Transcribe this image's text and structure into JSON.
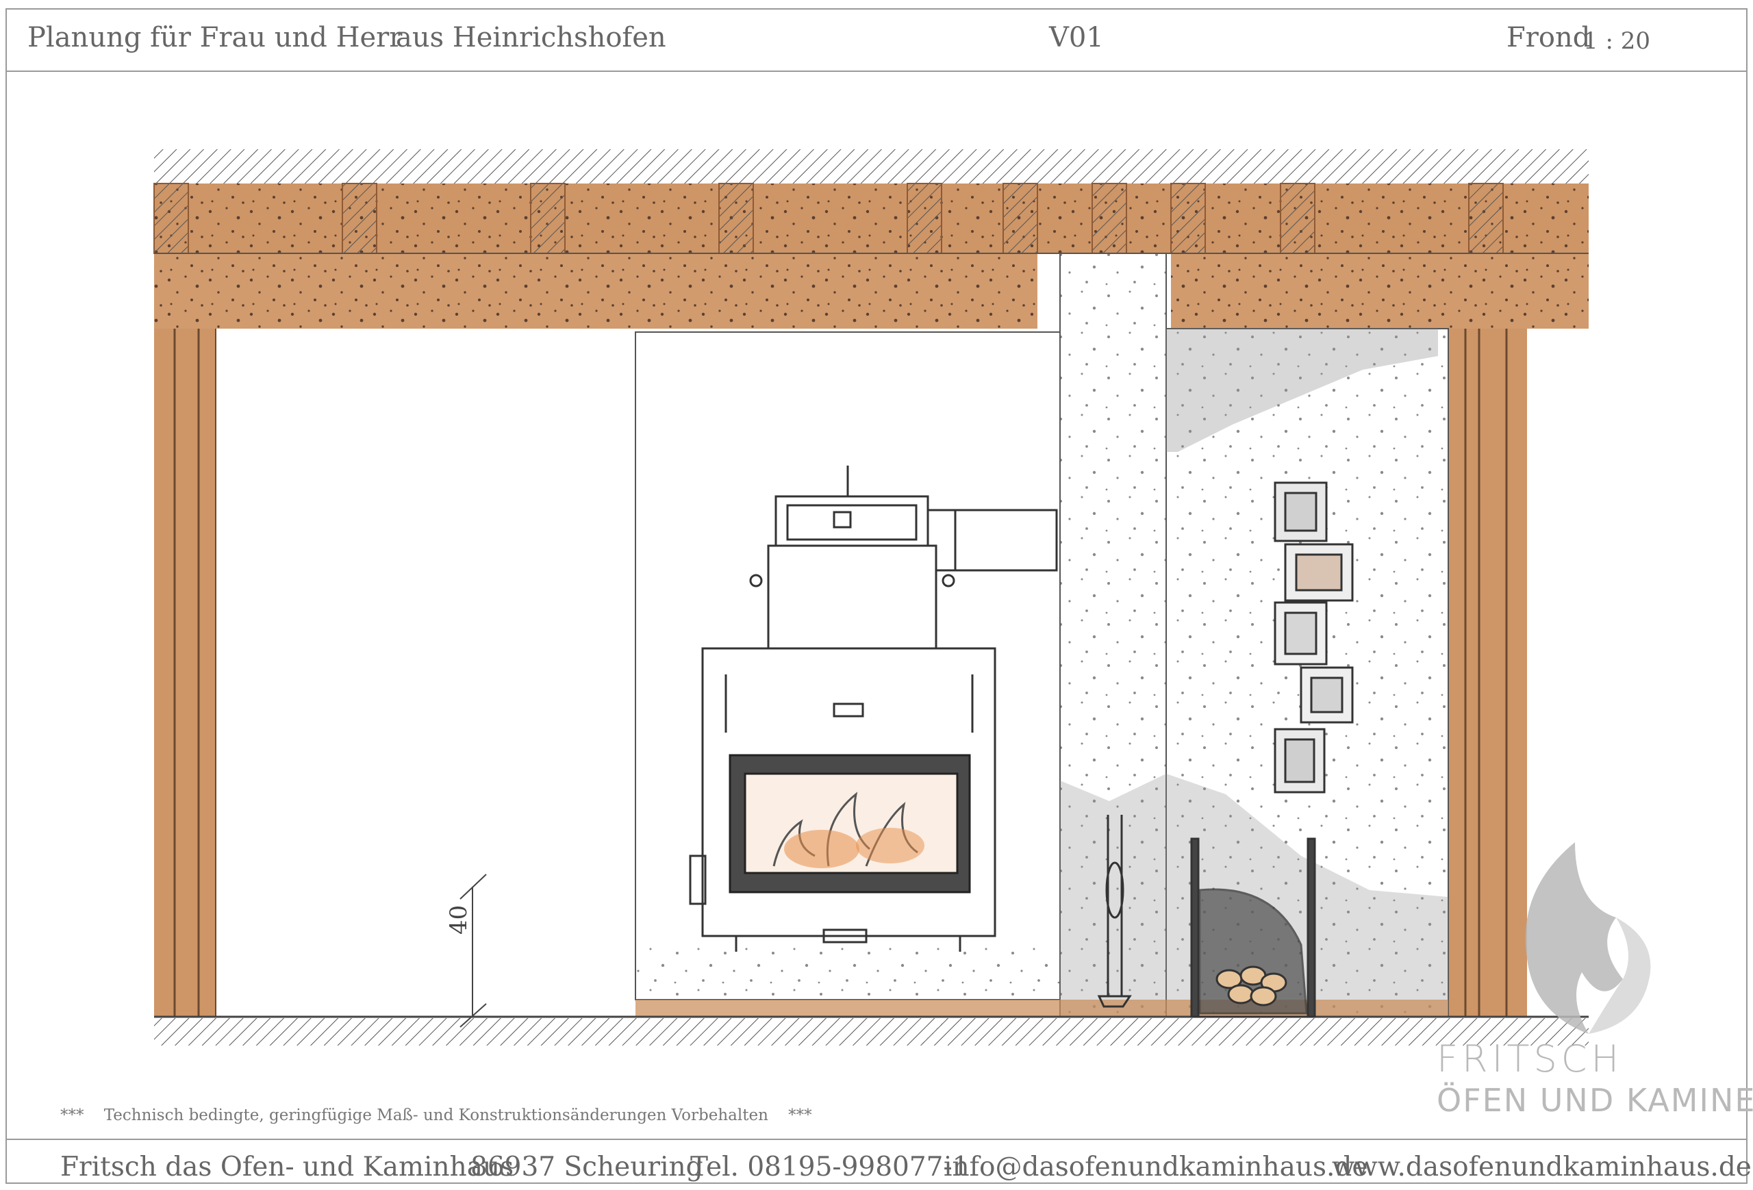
{
  "header": {
    "planning": "Planung für Frau und Herr",
    "location": "aus Heinrichshofen",
    "version": "V01",
    "view": "Frond",
    "scale": "1 : 20"
  },
  "drawing": {
    "dimension_label": "40"
  },
  "disclaimer": {
    "stars_left": "***",
    "text": "Technisch bedingte, geringfügige Maß- und Konstruktionsänderungen Vorbehalten",
    "stars_right": "***"
  },
  "logo": {
    "line1": "FRITSCH",
    "line2": "ÖFEN UND KAMINE"
  },
  "footer": {
    "company": "Fritsch das Ofen- und Kaminhaus",
    "address": "86937 Scheuring",
    "phone": "Tel. 08195-998077-1",
    "email": "info@dasofenundkaminhaus.de",
    "website": "www.dasofenundkaminhaus.de"
  },
  "colors": {
    "wood": "#c98a55",
    "wood_dark": "#8e5a35",
    "speckle": "#5b4030",
    "stove_line": "#333333"
  }
}
